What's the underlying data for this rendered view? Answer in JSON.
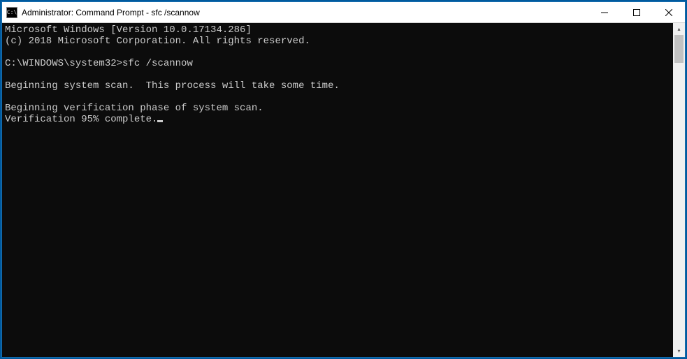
{
  "window": {
    "title": "Administrator: Command Prompt - sfc  /scannow",
    "icon_glyph": "C:\\"
  },
  "controls": {
    "minimize": "minimize",
    "maximize": "maximize",
    "close": "close"
  },
  "console": {
    "line1": "Microsoft Windows [Version 10.0.17134.286]",
    "line2": "(c) 2018 Microsoft Corporation. All rights reserved.",
    "blank1": "",
    "prompt": "C:\\WINDOWS\\system32>",
    "command": "sfc /scannow",
    "blank2": "",
    "line3": "Beginning system scan.  This process will take some time.",
    "blank3": "",
    "line4": "Beginning verification phase of system scan.",
    "line5": "Verification 95% complete."
  }
}
